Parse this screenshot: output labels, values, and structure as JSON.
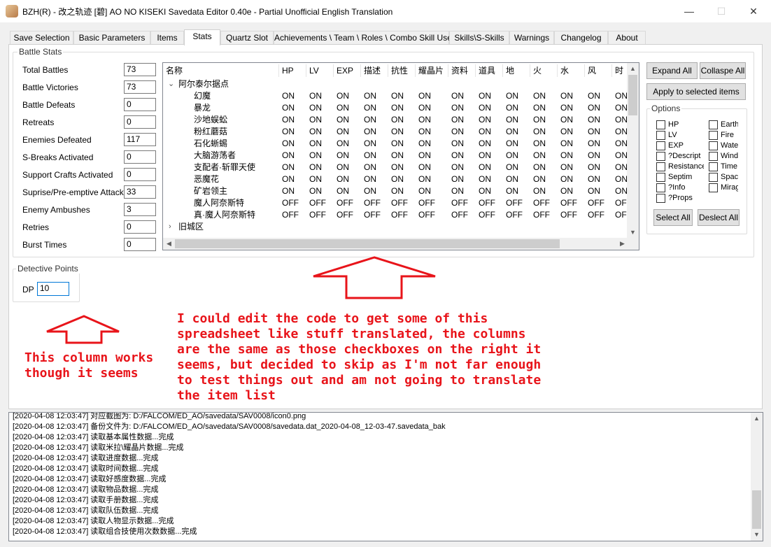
{
  "window": {
    "title": "BZH(R) - 改之轨迹 [碧] AO NO KISEKI Savedata Editor 0.40e - Partial Unofficial English Translation"
  },
  "tabs": [
    {
      "label": "Save Selection",
      "active": false
    },
    {
      "label": "Basic Parameters",
      "active": false
    },
    {
      "label": "Items",
      "active": false
    },
    {
      "label": "Stats",
      "active": true
    },
    {
      "label": "Quartz Slot",
      "active": false
    },
    {
      "label": "Achievements \\ Team \\ Roles \\ Combo Skill Uses",
      "active": false
    },
    {
      "label": "Skills\\S-Skills",
      "active": false
    },
    {
      "label": "Warnings",
      "active": false
    },
    {
      "label": "Changelog",
      "active": false
    },
    {
      "label": "About",
      "active": false
    }
  ],
  "battle_stats": {
    "legend": "Battle Stats",
    "fields": [
      {
        "label": "Total Battles",
        "value": "73"
      },
      {
        "label": "Battle Victories",
        "value": "73"
      },
      {
        "label": "Battle Defeats",
        "value": "0"
      },
      {
        "label": "Retreats",
        "value": "0"
      },
      {
        "label": "Enemies Defeated",
        "value": "117"
      },
      {
        "label": "S-Breaks Activated",
        "value": "0"
      },
      {
        "label": "Support Crafts Activated",
        "value": "0"
      },
      {
        "label": "Suprise/Pre-emptive Attacks",
        "value": "33"
      },
      {
        "label": "Enemy Ambushes",
        "value": "3"
      },
      {
        "label": "Retries",
        "value": "0"
      },
      {
        "label": "Burst Times",
        "value": "0"
      }
    ]
  },
  "tree": {
    "columns": [
      "名称",
      "HP",
      "LV",
      "EXP",
      "描述",
      "抗性",
      "耀晶片",
      "资料",
      "道具",
      "地",
      "火",
      "水",
      "风",
      "时"
    ],
    "group1": "阿尔泰尔据点",
    "rows": [
      {
        "name": "幻魔",
        "vals": [
          "ON",
          "ON",
          "ON",
          "ON",
          "ON",
          "ON",
          "ON",
          "ON",
          "ON",
          "ON",
          "ON",
          "ON",
          "ON"
        ]
      },
      {
        "name": "暴龙",
        "vals": [
          "ON",
          "ON",
          "ON",
          "ON",
          "ON",
          "ON",
          "ON",
          "ON",
          "ON",
          "ON",
          "ON",
          "ON",
          "ON"
        ]
      },
      {
        "name": "沙地蜈蚣",
        "vals": [
          "ON",
          "ON",
          "ON",
          "ON",
          "ON",
          "ON",
          "ON",
          "ON",
          "ON",
          "ON",
          "ON",
          "ON",
          "ON"
        ]
      },
      {
        "name": "粉红蘑菇",
        "vals": [
          "ON",
          "ON",
          "ON",
          "ON",
          "ON",
          "ON",
          "ON",
          "ON",
          "ON",
          "ON",
          "ON",
          "ON",
          "ON"
        ]
      },
      {
        "name": "石化蜥蜴",
        "vals": [
          "ON",
          "ON",
          "ON",
          "ON",
          "ON",
          "ON",
          "ON",
          "ON",
          "ON",
          "ON",
          "ON",
          "ON",
          "ON"
        ]
      },
      {
        "name": "大脑游荡者",
        "vals": [
          "ON",
          "ON",
          "ON",
          "ON",
          "ON",
          "ON",
          "ON",
          "ON",
          "ON",
          "ON",
          "ON",
          "ON",
          "ON"
        ]
      },
      {
        "name": "支配者·斩罪天使",
        "vals": [
          "ON",
          "ON",
          "ON",
          "ON",
          "ON",
          "ON",
          "ON",
          "ON",
          "ON",
          "ON",
          "ON",
          "ON",
          "ON"
        ]
      },
      {
        "name": "恶魔花",
        "vals": [
          "ON",
          "ON",
          "ON",
          "ON",
          "ON",
          "ON",
          "ON",
          "ON",
          "ON",
          "ON",
          "ON",
          "ON",
          "ON"
        ]
      },
      {
        "name": "矿岩领主",
        "vals": [
          "ON",
          "ON",
          "ON",
          "ON",
          "ON",
          "ON",
          "ON",
          "ON",
          "ON",
          "ON",
          "ON",
          "ON",
          "ON"
        ]
      },
      {
        "name": "魔人阿奈斯特",
        "vals": [
          "OFF",
          "OFF",
          "OFF",
          "OFF",
          "OFF",
          "OFF",
          "OFF",
          "OFF",
          "OFF",
          "OFF",
          "OFF",
          "OFF",
          "OFF"
        ]
      },
      {
        "name": "真·魔人阿奈斯特",
        "vals": [
          "OFF",
          "OFF",
          "OFF",
          "OFF",
          "OFF",
          "OFF",
          "OFF",
          "OFF",
          "OFF",
          "OFF",
          "OFF",
          "OFF",
          "OFF"
        ]
      }
    ],
    "group2": "旧城区"
  },
  "buttons": {
    "expand_all": "Expand All",
    "collapse_all": "Collaspe All",
    "apply": "Apply to selected items",
    "select_all": "Select All",
    "deselect_all": "Deslect All"
  },
  "options": {
    "legend": "Options",
    "left": [
      "HP",
      "LV",
      "EXP",
      "?Descript",
      "Resistance",
      "Septim",
      "?Info",
      "?Props"
    ],
    "right": [
      "Earth",
      "Fire",
      "Water",
      "Wind",
      "Time",
      "Space",
      "Mirage"
    ]
  },
  "detective": {
    "legend": "Detective Points",
    "label": "DP",
    "value": "10"
  },
  "annotations": {
    "right": "I could edit the code to get some of this\nspreadsheet like stuff translated, the columns\nare the same as those checkboxes on the right it\nseems, but decided to skip as I'm not far enough\nto test things out and am not going to translate\nthe item list",
    "left": "This column works\nthough it seems"
  },
  "log": [
    "[2020-04-08 12:03:47] 对应截图为: D:/FALCOM/ED_AO/savedata/SAV0008/icon0.png",
    "[2020-04-08 12:03:47] 备份文件为: D:/FALCOM/ED_AO/savedata/SAV0008/savedata.dat_2020-04-08_12-03-47.savedata_bak",
    "[2020-04-08 12:03:47] 读取基本属性数据...完成",
    "[2020-04-08 12:03:47] 读取米拉\\耀晶片数据...完成",
    "[2020-04-08 12:03:47] 读取进度数据...完成",
    "[2020-04-08 12:03:47] 读取时间数据...完成",
    "[2020-04-08 12:03:47] 读取好感度数据...完成",
    "[2020-04-08 12:03:47] 读取物品数据...完成",
    "[2020-04-08 12:03:47] 读取手册数据...完成",
    "[2020-04-08 12:03:47] 读取队伍数据...完成",
    "[2020-04-08 12:03:47] 读取人物显示数据...完成",
    "[2020-04-08 12:03:47] 读取组合技使用次数数据...完成"
  ],
  "colors": {
    "annotation": "#e8141a",
    "window_bg": "#f0f0f0"
  }
}
